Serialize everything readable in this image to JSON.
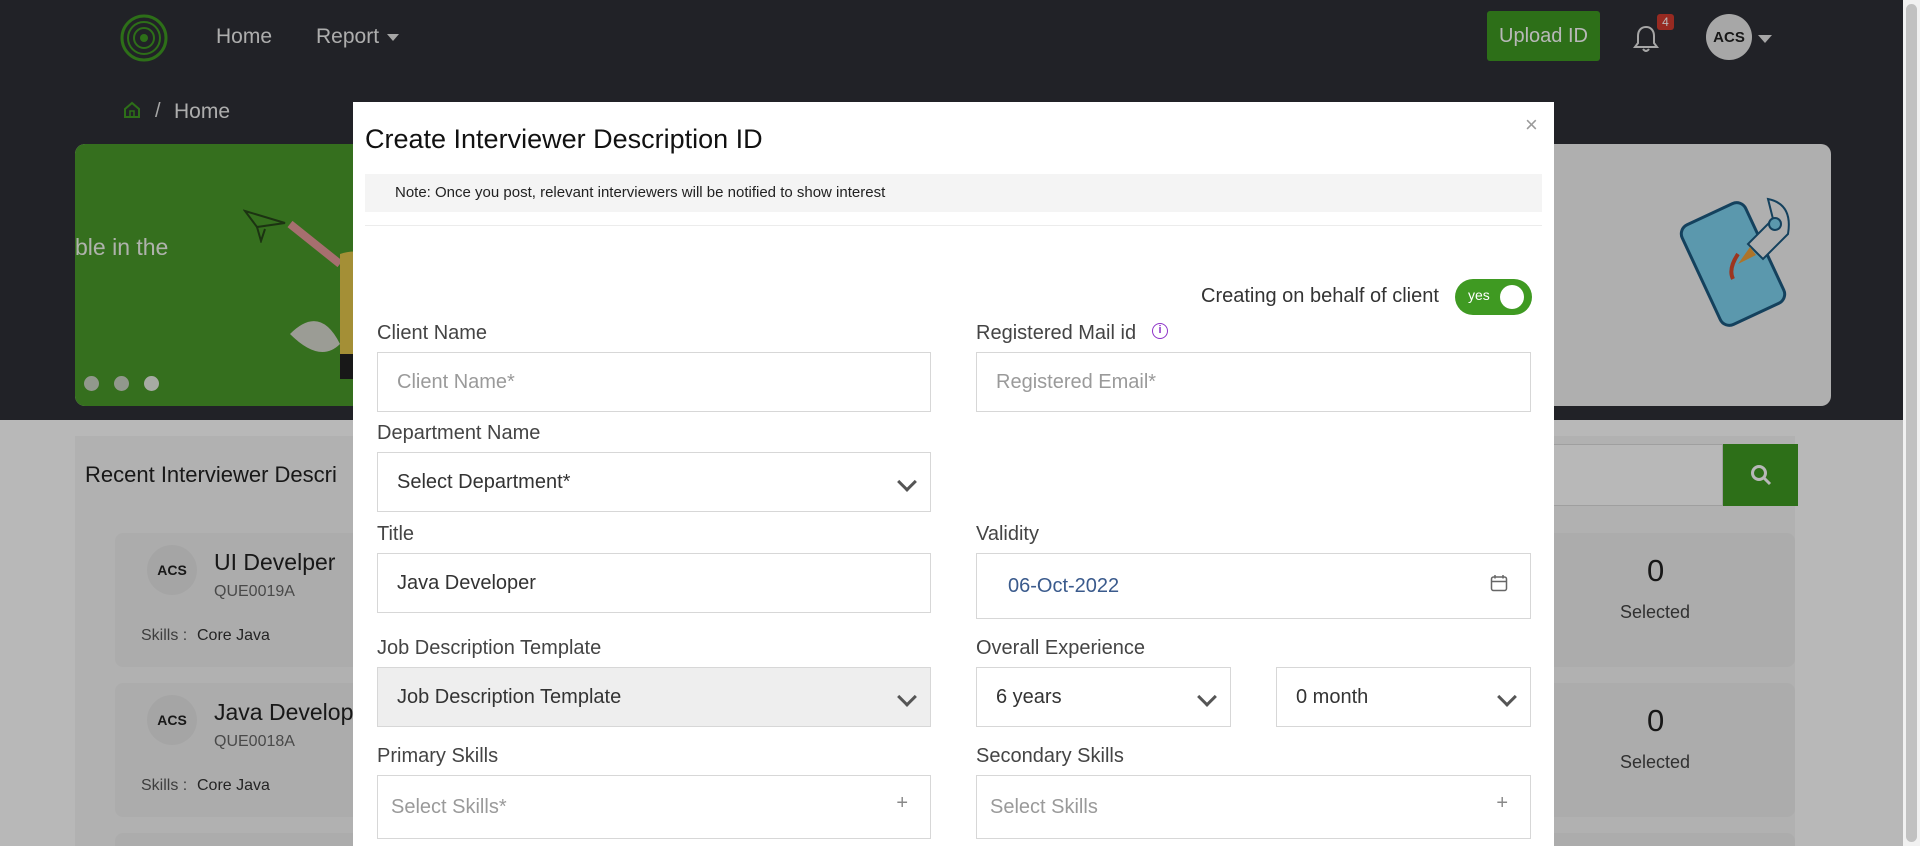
{
  "nav": {
    "home": "Home",
    "report": "Report",
    "upload_btn": "Upload ID",
    "notif_count": "4",
    "avatar_text": "ACS"
  },
  "breadcrumb": {
    "current": "Home",
    "sep": "/"
  },
  "banner": {
    "text": "ble in the"
  },
  "recent": {
    "title": "Recent Interviewer Descri",
    "jobs": [
      {
        "title": "UI Develper",
        "code": "QUE0019A",
        "skills_label": "Skills :",
        "skills": "Core Java",
        "count": "0",
        "count_label": "Selected",
        "logo": "ACS"
      },
      {
        "title": "Java Develop",
        "code": "QUE0018A",
        "skills_label": "Skills :",
        "skills": "Core Java",
        "count": "0",
        "count_label": "Selected",
        "logo": "ACS"
      }
    ]
  },
  "modal": {
    "title": "Create Interviewer Description ID",
    "close": "×",
    "note": "Note: Once you post, relevant interviewers will be notified to show interest",
    "behalf_label": "Creating on behalf of client",
    "toggle_text": "yes",
    "client_name_label": "Client Name",
    "client_name_placeholder": "Client Name*",
    "reg_mail_label": "Registered Mail id",
    "reg_mail_placeholder": "Registered Email*",
    "dept_label": "Department Name",
    "dept_value": "Select Department*",
    "title_label": "Title",
    "title_value": "Java Developer",
    "validity_label": "Validity",
    "validity_value": "06-Oct-2022",
    "jd_label": "Job Description Template",
    "jd_value": "Job Description Template",
    "exp_label": "Overall Experience",
    "exp_years": "6 years",
    "exp_months": "0 month",
    "primary_label": "Primary Skills",
    "primary_placeholder": "Select Skills*",
    "secondary_label": "Secondary Skills",
    "secondary_placeholder": "Select Skills",
    "plus": "+"
  },
  "colors": {
    "accent_green": "#3f9a22",
    "topbar": "#2e3036",
    "info_purple": "#8e34c8",
    "date_text": "#3a5a8c"
  }
}
